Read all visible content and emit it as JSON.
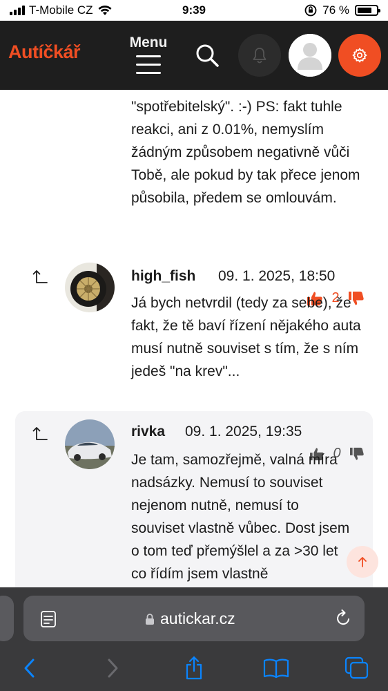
{
  "status_bar": {
    "carrier": "T-Mobile CZ",
    "time": "9:39",
    "battery": "76 %",
    "battery_level": 0.76
  },
  "header": {
    "logo": "Autíčkář",
    "menu_label": "Menu"
  },
  "previous_comment": {
    "clipped_line": "... .. ...... ... .. .... .. ...",
    "text": "\"spotřebitelský\". :-) PS: fakt tuhle reakci, ani z 0.01%, nemyslím žádným způsobem negativně vůči Tobě, ale pokud by tak přece jenom působila, předem se omlouvám."
  },
  "comments": [
    {
      "author": "high_fish",
      "date": "09. 1. 2025, 18:50",
      "votes": "2",
      "text": "Já bych netvrdil (tedy za sebe), že fakt, že tě baví řízení nějakého auta musí nutně souviset s tím, že s ním jedeš \"na krev\"..."
    },
    {
      "author": "rivka",
      "date": "09. 1. 2025, 19:35",
      "votes": "0",
      "text": "Je tam, samozřejmě, valná míra nadsázky. Nemusí to souviset nejenom nutně, nemusí to souviset vlastně vůbec. Dost jsem o tom teď přemýšlel a za >30 let co řídím jsem vlastně"
    }
  ],
  "browser": {
    "url": "autickar.cz"
  },
  "colors": {
    "brand": "#f04e23",
    "header_bg": "#1e1e1e",
    "vote_active": "#f04e23",
    "vote_inactive": "#555555"
  }
}
